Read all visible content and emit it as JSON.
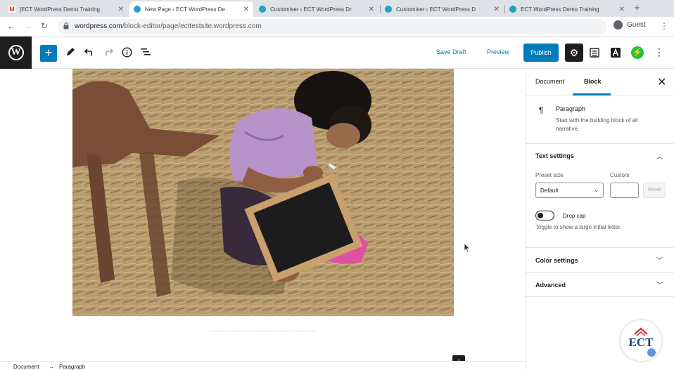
{
  "browser": {
    "tabs": [
      {
        "title": "[ECT WordPress Demo Training",
        "icon": "gmail-icon",
        "active": false
      },
      {
        "title": "New Page ‹ ECT WordPress De",
        "icon": "wordpress-icon",
        "active": true
      },
      {
        "title": "Customiser ‹ ECT WordPress Dr",
        "icon": "wordpress-icon",
        "active": false
      },
      {
        "title": "Customiser ‹ ECT WordPress D",
        "icon": "wordpress-icon",
        "active": false
      },
      {
        "title": "ECT WordPress Demo Training",
        "icon": "wordpress-icon",
        "active": false
      }
    ],
    "new_tab": "+",
    "url_domain": "wordpress.com",
    "url_path": "/block-editor/page/ecttestsite.wordpress.com",
    "profile_label": "Guest"
  },
  "editor": {
    "save_draft": "Save Draft",
    "preview": "Preview",
    "publish": "Publish",
    "add_block": "+"
  },
  "canvas": {
    "caption": "........... ....... ........ ........... ........... ........ ......",
    "plus": "+"
  },
  "footer": {
    "crumb_1": "Document",
    "arrow": "→",
    "crumb_2": "Paragraph"
  },
  "sidebar": {
    "tab_document": "Document",
    "tab_block": "Block",
    "close": "✕",
    "block_name": "Paragraph",
    "block_desc": "Start with the building block of all narrative.",
    "text_settings": "Text settings",
    "preset_size_label": "Preset size",
    "preset_size_value": "Default",
    "custom_label": "Custom",
    "reset": "Reset",
    "drop_cap": "Drop cap",
    "drop_cap_help": "Toggle to show a large initial letter.",
    "color_settings": "Color settings",
    "advanced": "Advanced"
  },
  "watermark": {
    "text": "ECT"
  },
  "colors": {
    "accent": "#007cba",
    "dark": "#1e1e1e",
    "green": "#24c339"
  }
}
